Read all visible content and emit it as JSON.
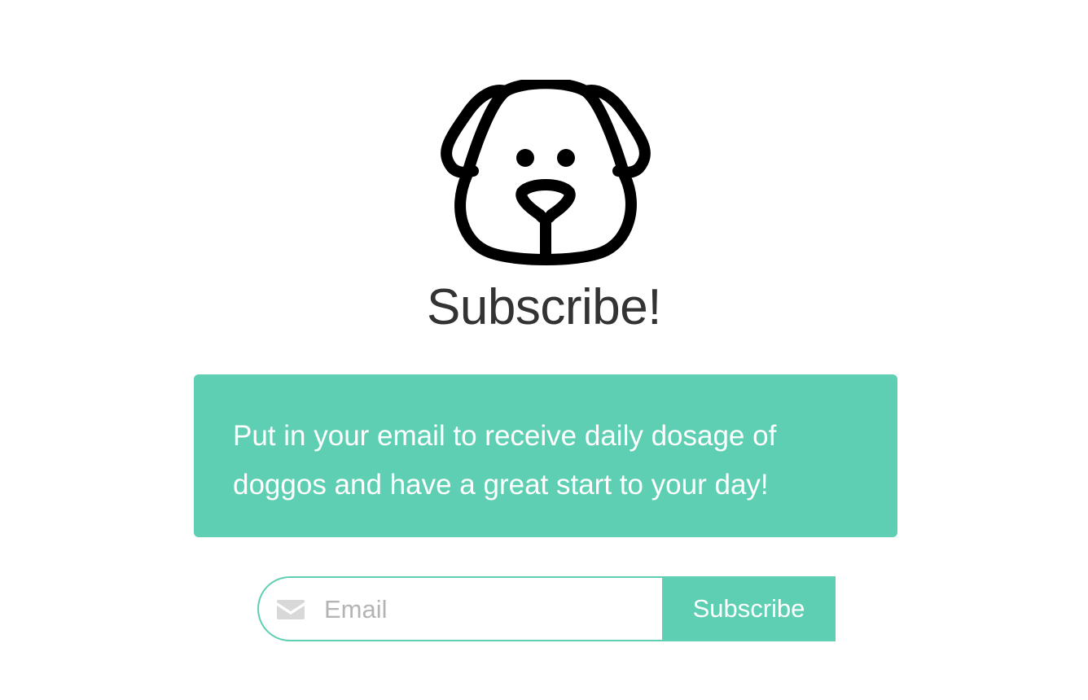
{
  "header": {
    "logo_icon": "dog-face-icon",
    "title": "Subscribe!"
  },
  "banner": {
    "text": "Put in your email to receive daily dosage of doggos and have a great start to your day!",
    "background_color": "#5ecfb2"
  },
  "form": {
    "email_icon": "envelope-icon",
    "email_placeholder": "Email",
    "email_value": "",
    "submit_label": "Subscribe",
    "accent_color": "#5ecfb2"
  }
}
